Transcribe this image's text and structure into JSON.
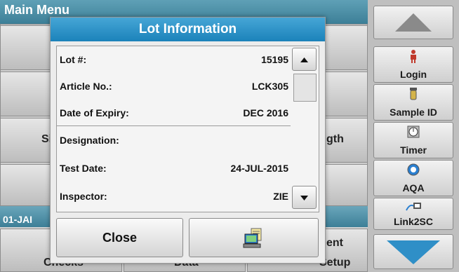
{
  "background": {
    "title": "Main Menu",
    "tiles": [
      "Si",
      "gth",
      "ent",
      "01-JAI"
    ],
    "status_date": "01-JAI",
    "bottom_labels": [
      "Checks",
      "Data",
      "Setup"
    ]
  },
  "sidebar": {
    "login": "Login",
    "sample_id": "Sample ID",
    "timer": "Timer",
    "aqa": "AQA",
    "link2sc": "Link2SC"
  },
  "dialog": {
    "title": "Lot Information",
    "rows": [
      {
        "label": "Lot #:",
        "value": "15195"
      },
      {
        "label": "Article No.:",
        "value": "LCK305"
      },
      {
        "label": "Date of Expiry:",
        "value": "DEC 2016"
      },
      {
        "label": "Designation:",
        "value": ""
      },
      {
        "label": "Test Date:",
        "value": "24-JUL-2015"
      },
      {
        "label": "Inspector:",
        "value": "ZIE"
      }
    ],
    "close_label": "Close",
    "scroll_position": 0.17
  },
  "colors": {
    "title_bar": "#1b82ba",
    "menu_bar": "#3c7f97",
    "nav_arrow": "#2f8fc7"
  },
  "icons": [
    "arrow-up-icon",
    "arrow-down-icon",
    "person-icon",
    "sample-vial-icon",
    "timer-icon",
    "aqa-icon",
    "link2sc-icon",
    "computer-icon"
  ]
}
